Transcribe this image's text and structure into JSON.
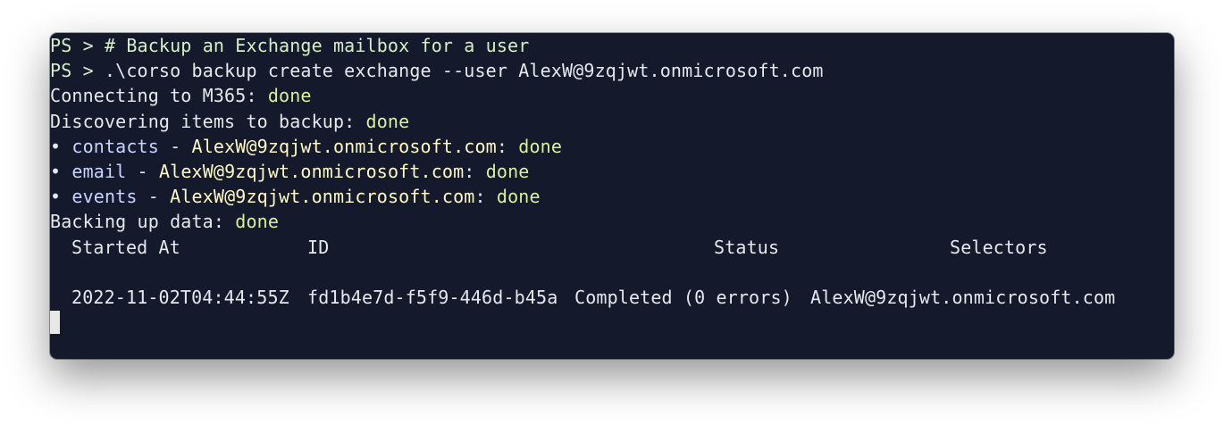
{
  "terminal": {
    "prompt": "PS > ",
    "comment_line": "# Backup an Exchange mailbox for a user",
    "command_line": ".\\corso backup create exchange --user AlexW@9zqjwt.onmicrosoft.com",
    "connecting_label": "Connecting to M365: ",
    "discovering_label": "Discovering items to backup: ",
    "done": "done",
    "bullet": "• ",
    "separator": " - ",
    "colon": ": ",
    "items": [
      {
        "name": "contacts",
        "user": "AlexW@9zqjwt.onmicrosoft.com"
      },
      {
        "name": "email",
        "user": "AlexW@9zqjwt.onmicrosoft.com"
      },
      {
        "name": "events",
        "user": "AlexW@9zqjwt.onmicrosoft.com"
      }
    ],
    "backing_label": "Backing up data: ",
    "table": {
      "headers": [
        "Started At",
        "ID",
        "Status",
        "Selectors"
      ],
      "rows": [
        [
          "2022-11-02T04:44:55Z",
          "fd1b4e7d-f5f9-446d-b45a",
          "Completed (0 errors)",
          "AlexW@9zqjwt.onmicrosoft.com"
        ]
      ]
    }
  },
  "colors": {
    "background": "#141a2c",
    "done": "#dcef9a",
    "item_name": "#c9d3ff",
    "user": "#fff9c4"
  }
}
